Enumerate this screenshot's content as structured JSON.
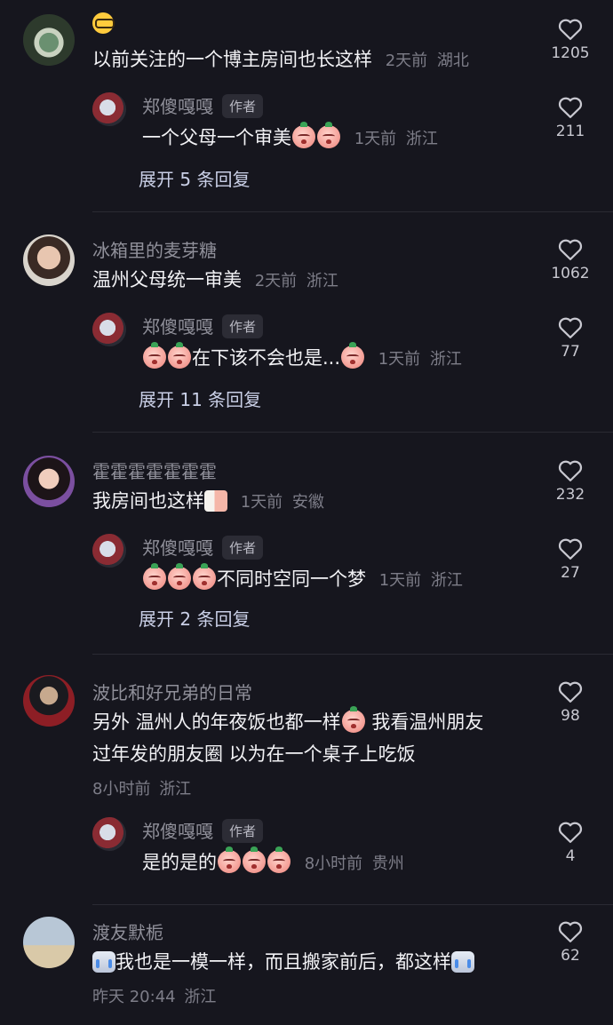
{
  "comments": [
    {
      "name": "",
      "emoji_name": "nerd-face-emoji",
      "text": "以前关注的一个博主房间也长这样",
      "time": "2天前",
      "location": "湖北",
      "likes": "1205",
      "reply": {
        "name": "郑傻嘎嘎",
        "badge": "作者",
        "text": "一个父母一个审美",
        "time": "1天前",
        "location": "浙江",
        "likes": "211"
      },
      "expand": "展开 5 条回复"
    },
    {
      "name": "冰箱里的麦芽糖",
      "text": "温州父母统一审美",
      "time": "2天前",
      "location": "浙江",
      "likes": "1062",
      "reply": {
        "name": "郑傻嘎嘎",
        "badge": "作者",
        "text": "在下该不会也是...",
        "time": "1天前",
        "location": "浙江",
        "likes": "77"
      },
      "expand": "展开 11 条回复"
    },
    {
      "name": "霍霍霍霍霍霍霍",
      "text": "我房间也这样",
      "time": "1天前",
      "location": "安徽",
      "likes": "232",
      "reply": {
        "name": "郑傻嘎嘎",
        "badge": "作者",
        "text": "不同时空同一个梦",
        "time": "1天前",
        "location": "浙江",
        "likes": "27"
      },
      "expand": "展开 2 条回复"
    },
    {
      "name": "波比和好兄弟的日常",
      "text_line1_a": "另外 温州人的年夜饭也都一样",
      "text_line1_b": " 我看温州朋友",
      "text_line2": "过年发的朋友圈 以为在一个桌子上吃饭",
      "time": "8小时前",
      "location": "浙江",
      "likes": "98",
      "reply": {
        "name": "郑傻嘎嘎",
        "badge": "作者",
        "text": "是的是的",
        "time": "8小时前",
        "location": "贵州",
        "likes": "4"
      }
    },
    {
      "name": "渡友默栀",
      "text": "我也是一模一样，而且搬家前后，都这样",
      "time": "昨天 20:44",
      "location": "浙江",
      "likes": "62"
    }
  ],
  "colors": {
    "background": "#16161e",
    "secondary_text": "#7d7d88",
    "expand_link": "#c9cfe6"
  },
  "icons": {
    "like": "heart-outline-icon",
    "tomato": "crying-tomato-emoji",
    "cry": "crying-face-emoji"
  }
}
